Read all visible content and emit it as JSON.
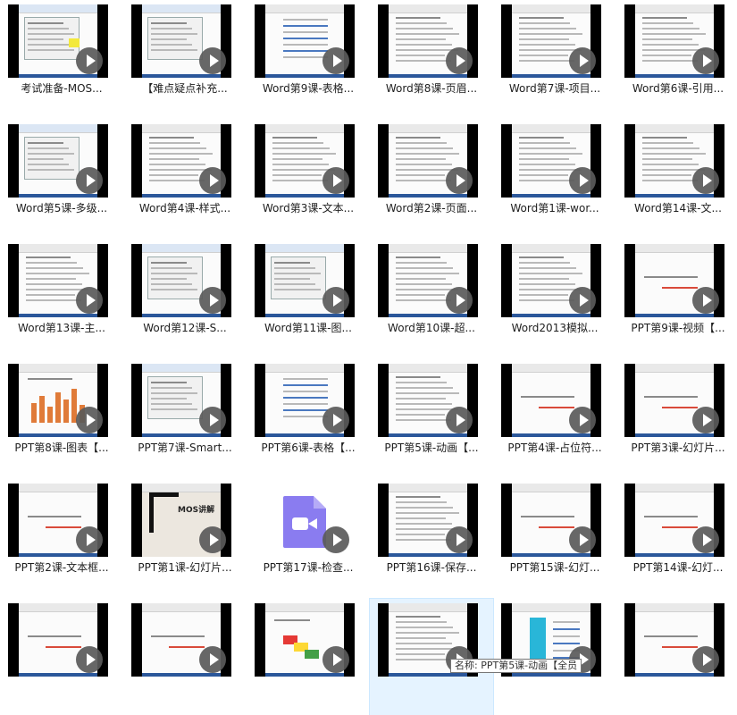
{
  "tooltip": {
    "text": "名称: PPT第5课-动画【全员"
  },
  "videos": [
    {
      "title": "考试准备-MOS...",
      "style": "form"
    },
    {
      "title": "【难点疑点补充...",
      "style": "sheet"
    },
    {
      "title": "Word第9课-表格...",
      "style": "table"
    },
    {
      "title": "Word第8课-页眉...",
      "style": "page"
    },
    {
      "title": "Word第7课-项目...",
      "style": "list"
    },
    {
      "title": "Word第6课-引用...",
      "style": "doc"
    },
    {
      "title": "Word第5课-多级...",
      "style": "dialog"
    },
    {
      "title": "Word第4课-样式...",
      "style": "text"
    },
    {
      "title": "Word第3课-文本...",
      "style": "text"
    },
    {
      "title": "Word第2课-页面...",
      "style": "text"
    },
    {
      "title": "Word第1课-wor...",
      "style": "page"
    },
    {
      "title": "Word第14课-文...",
      "style": "doc"
    },
    {
      "title": "Word第13课-主...",
      "style": "text"
    },
    {
      "title": "Word第12课-S...",
      "style": "dialog"
    },
    {
      "title": "Word第11课-图...",
      "style": "dialog"
    },
    {
      "title": "Word第10课-超...",
      "style": "list"
    },
    {
      "title": "Word2013模拟...",
      "style": "list"
    },
    {
      "title": "PPT第9课-视频【...",
      "style": "slide"
    },
    {
      "title": "PPT第8课-图表【...",
      "style": "chart"
    },
    {
      "title": "PPT第7课-Smart...",
      "style": "dialog"
    },
    {
      "title": "PPT第6课-表格【...",
      "style": "table"
    },
    {
      "title": "PPT第5课-动画【...",
      "style": "list"
    },
    {
      "title": "PPT第4课-占位符...",
      "style": "slide"
    },
    {
      "title": "PPT第3课-幻灯片...",
      "style": "slide"
    },
    {
      "title": "PPT第2课-文本框...",
      "style": "slide"
    },
    {
      "title": "PPT第1课-幻灯片...",
      "style": "logo",
      "logo_text": "MOS讲解"
    },
    {
      "title": "PPT第17课-检查...",
      "style": "icon"
    },
    {
      "title": "PPT第16课-保存...",
      "style": "list"
    },
    {
      "title": "PPT第15课-幻灯...",
      "style": "slide"
    },
    {
      "title": "PPT第14课-幻灯...",
      "style": "slide"
    },
    {
      "title": "",
      "style": "slide"
    },
    {
      "title": "",
      "style": "slide"
    },
    {
      "title": "",
      "style": "color"
    },
    {
      "title": "",
      "style": "list"
    },
    {
      "title": "",
      "style": "cyan"
    },
    {
      "title": "",
      "style": "slide"
    }
  ]
}
